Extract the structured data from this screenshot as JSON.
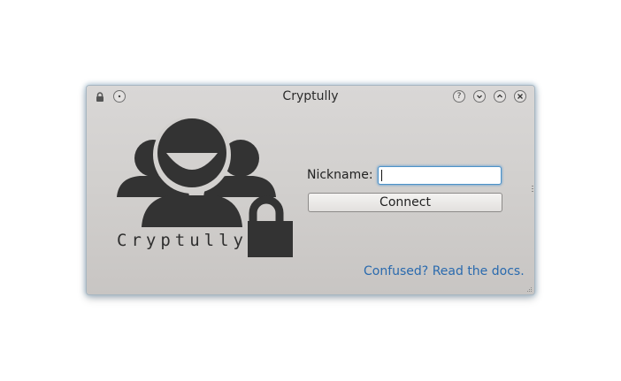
{
  "window": {
    "title": "Cryptully"
  },
  "titlebar": {
    "left_icons": [
      "lock-icon",
      "pin-icon"
    ],
    "buttons": [
      "help-icon",
      "minimize-icon",
      "maximize-icon",
      "close-icon"
    ],
    "help_glyph": "?",
    "minimize_glyph": "⌄",
    "maximize_glyph": "⌃",
    "close_glyph": "✕"
  },
  "logo": {
    "text": "Cryptully",
    "icon": "users-lock-icon",
    "color": "#333333"
  },
  "form": {
    "nickname_label": "Nickname:",
    "nickname_value": "",
    "connect_label": "Connect"
  },
  "footer": {
    "docs_link": "Confused? Read the docs."
  },
  "colors": {
    "link": "#2a6aae",
    "focus": "#4d92c8",
    "window_bg": "#d2d0ce"
  }
}
